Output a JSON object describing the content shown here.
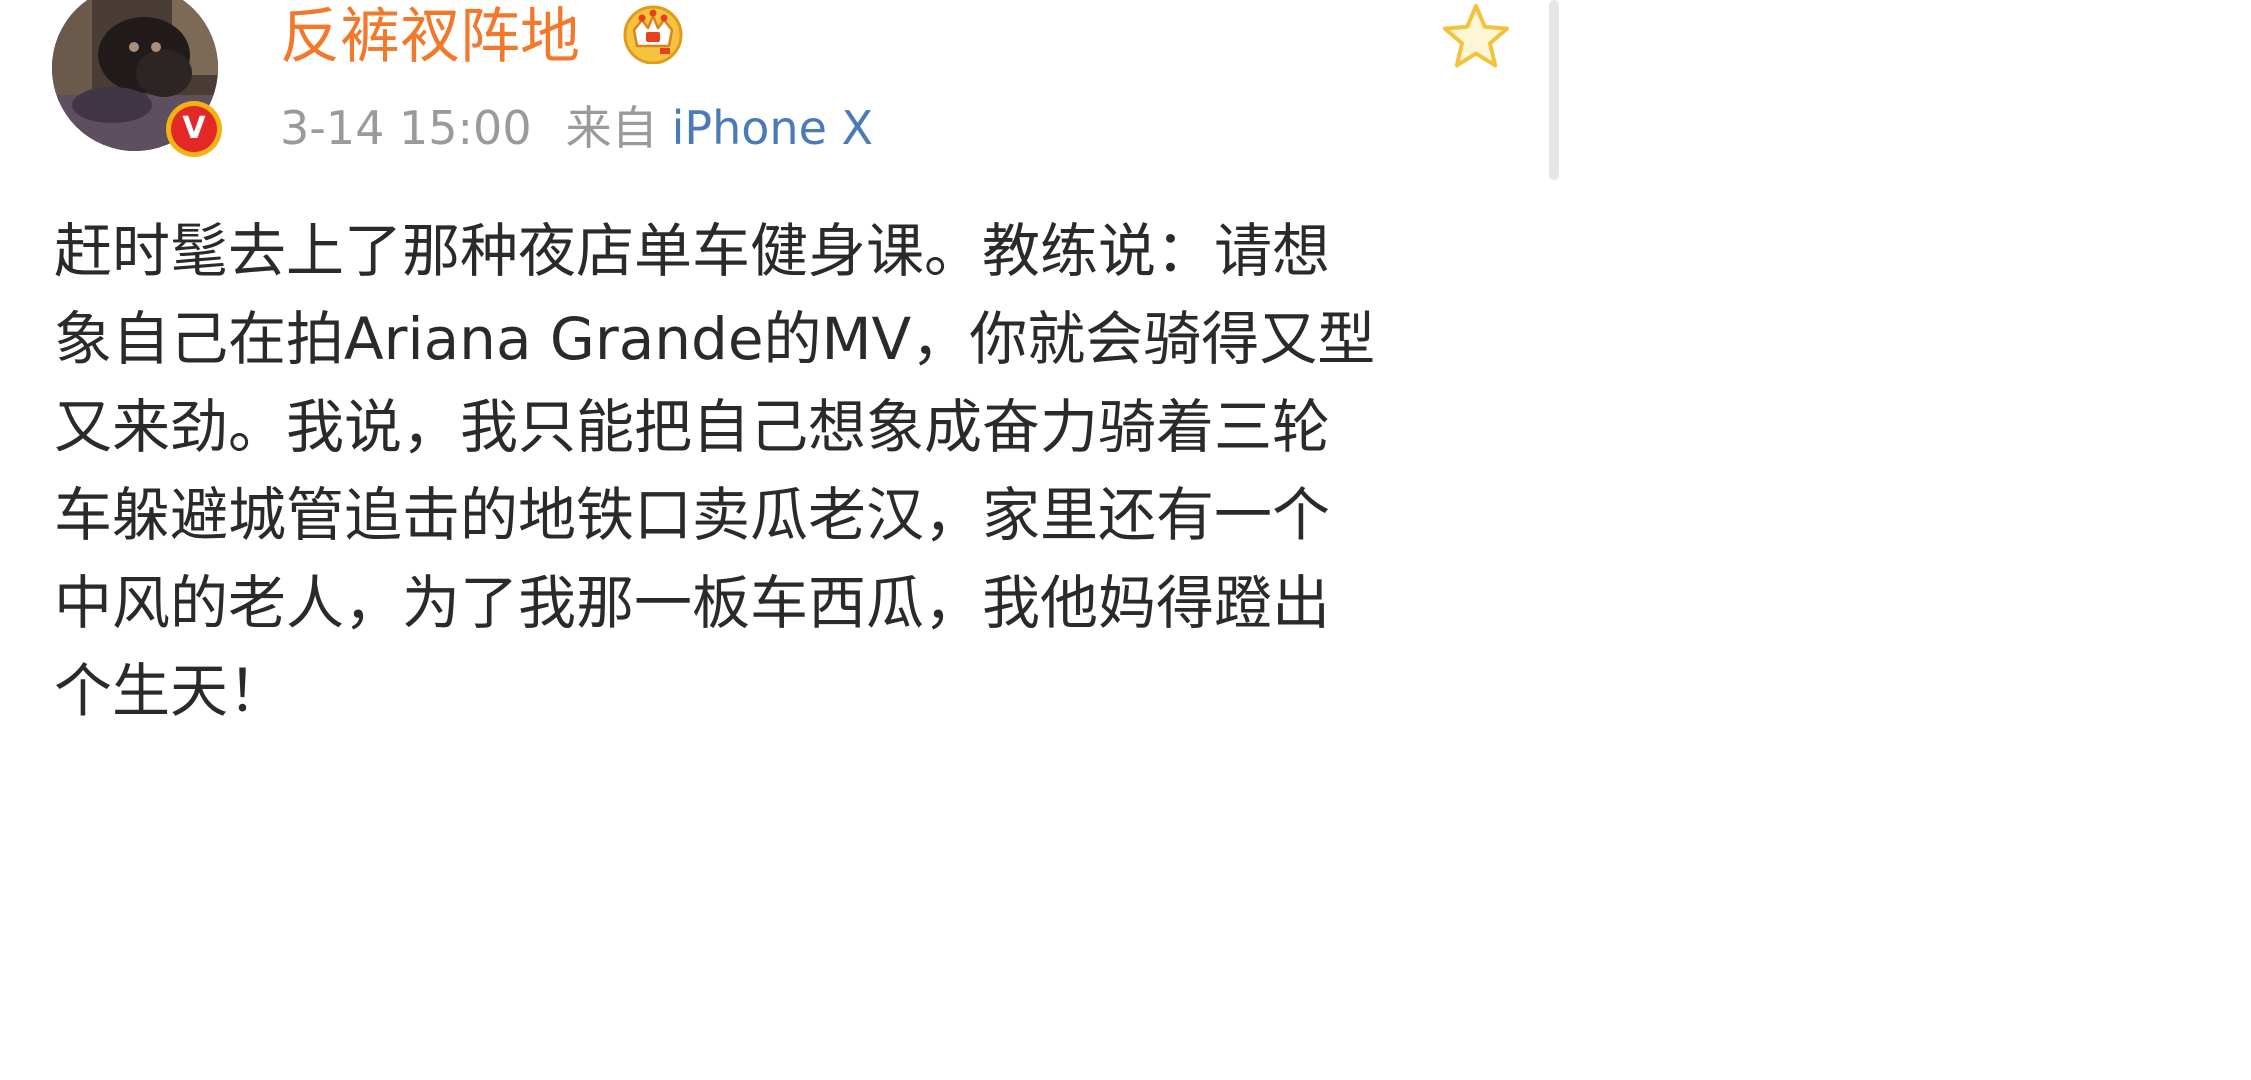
{
  "post": {
    "username": "反裤衩阵地",
    "timestamp": "3-14 15:00",
    "source_prefix": "来自",
    "source_device": "iPhone X",
    "verified_badge": "V",
    "body_lines": [
      "赶时髦去上了那种夜店单车健身课。教练说：请想",
      "象自己在拍Ariana Grande的MV，你就会骑得又型",
      "又来劲。我说，我只能把自己想象成奋力骑着三轮",
      "车躲避城管追击的地铁口卖瓜老汉，家里还有一个",
      "中风的老人，为了我那一板车西瓜，我他妈得蹬出",
      "个生天！"
    ]
  },
  "icons": {
    "avatar": "avatar-photo",
    "vip": "verified-v-icon",
    "member": "crown-icon",
    "favorite": "star-outline-icon"
  },
  "colors": {
    "username": "#f2782c",
    "meta_gray": "#9a9a9a",
    "device_link": "#4a7ab8",
    "body_text": "#2a2a2a",
    "badge_red": "#e42727",
    "badge_gold": "#f2b313",
    "star_gold": "#f2c23a"
  }
}
